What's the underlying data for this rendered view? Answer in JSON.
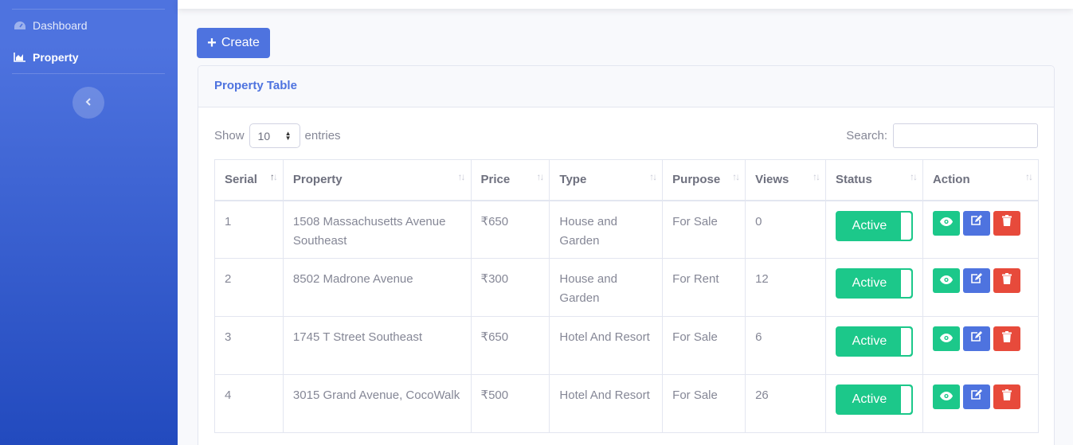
{
  "sidebar": {
    "items": [
      {
        "label": "Dashboard",
        "icon": "tachometer-icon"
      },
      {
        "label": "Property",
        "icon": "area-chart-icon",
        "active": true
      }
    ],
    "toggle_icon": "chevron-left-icon"
  },
  "toolbar": {
    "create_label": "Create",
    "create_icon": "plus-icon"
  },
  "card": {
    "title": "Property Table"
  },
  "table_controls": {
    "show_label": "Show",
    "entries_value": "10",
    "entries_label": "entries",
    "search_label": "Search:",
    "search_value": ""
  },
  "table": {
    "columns": [
      "Serial",
      "Property",
      "Price",
      "Type",
      "Purpose",
      "Views",
      "Status",
      "Action"
    ],
    "rows": [
      {
        "serial": "1",
        "property": "1508 Massachusetts Avenue Southeast",
        "price": "₹650",
        "type": "House and Garden",
        "purpose": "For Sale",
        "views": "0",
        "status": "Active"
      },
      {
        "serial": "2",
        "property": "8502 Madrone Avenue",
        "price": "₹300",
        "type": "House and Garden",
        "purpose": "For Rent",
        "views": "12",
        "status": "Active"
      },
      {
        "serial": "3",
        "property": "1745 T Street Southeast",
        "price": "₹650",
        "type": "Hotel And Resort",
        "purpose": "For Sale",
        "views": "6",
        "status": "Active"
      },
      {
        "serial": "4",
        "property": "3015 Grand Avenue, CocoWalk",
        "price": "₹500",
        "type": "Hotel And Resort",
        "purpose": "For Sale",
        "views": "26",
        "status": "Active"
      }
    ]
  },
  "colors": {
    "primary": "#4e73df",
    "success": "#1cc88a",
    "danger": "#e74a3b"
  }
}
